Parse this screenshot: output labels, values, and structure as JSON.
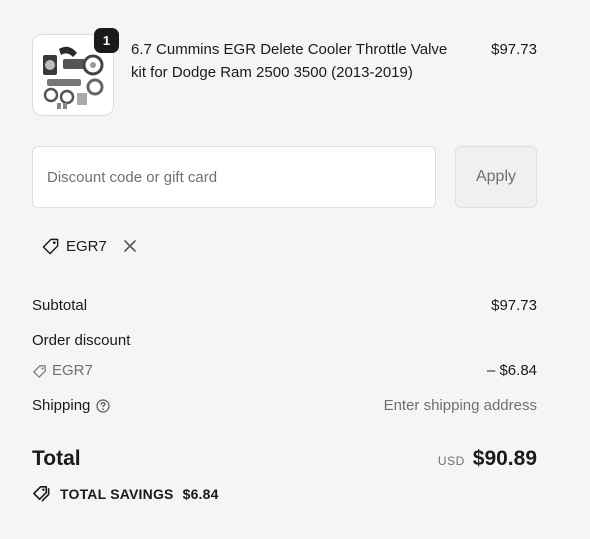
{
  "product": {
    "quantity": "1",
    "name": "6.7 Cummins EGR Delete Cooler Throttle Valve kit for Dodge Ram 2500 3500 (2013-2019)",
    "price": "$97.73",
    "thumbnail_icon": "egr-kit-parts-image"
  },
  "discount": {
    "placeholder": "Discount code or gift card",
    "value": "",
    "apply_label": "Apply",
    "applied_code": "EGR7",
    "remove_icon": "close-icon"
  },
  "totals": {
    "subtotal_label": "Subtotal",
    "subtotal_value": "$97.73",
    "order_discount_label": "Order discount",
    "discount_code": "EGR7",
    "discount_value": "– $6.84",
    "shipping_label": "Shipping",
    "shipping_value": "Enter shipping address",
    "total_label": "Total",
    "currency": "USD",
    "total_value": "$90.89",
    "savings_label": "TOTAL SAVINGS",
    "savings_value": "$6.84"
  },
  "colors": {
    "background": "#f5f5f5",
    "text": "#1a1a1a",
    "muted": "#707070",
    "border": "#dedede"
  }
}
